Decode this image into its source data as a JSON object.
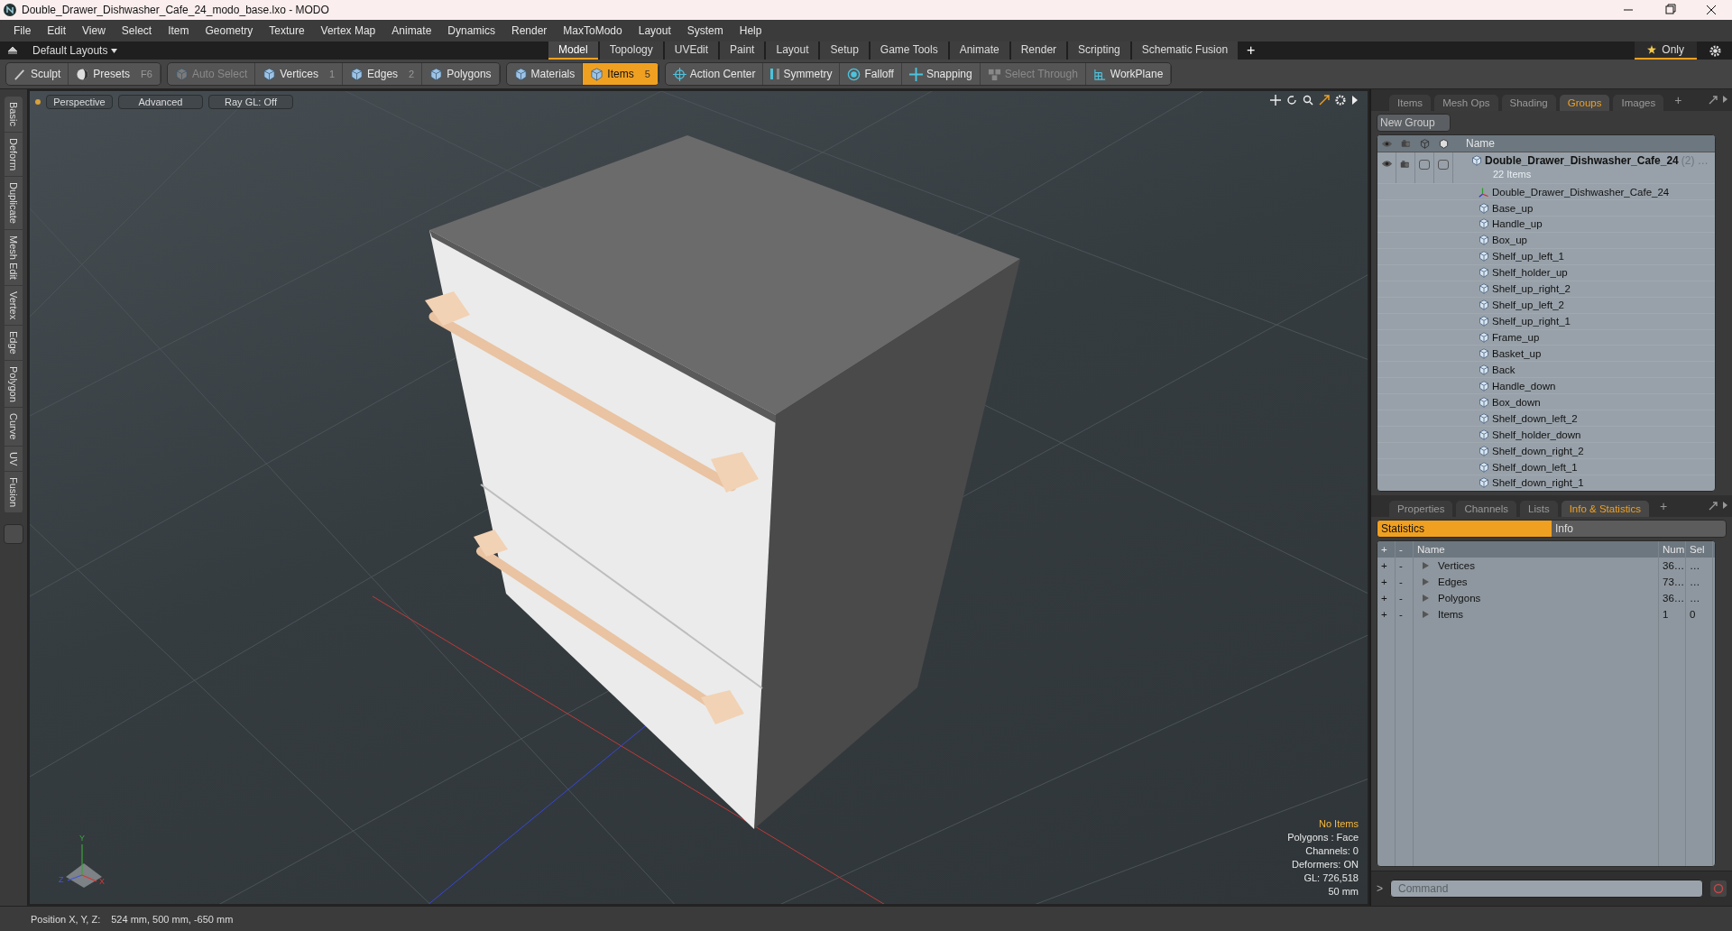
{
  "window": {
    "title": "Double_Drawer_Dishwasher_Cafe_24_modo_base.lxo - MODO"
  },
  "menu": [
    "File",
    "Edit",
    "View",
    "Select",
    "Item",
    "Geometry",
    "Texture",
    "Vertex Map",
    "Animate",
    "Dynamics",
    "Render",
    "MaxToModo",
    "Layout",
    "System",
    "Help"
  ],
  "layouts_menu": "Default Layouts",
  "layout_tabs": [
    {
      "label": "Model",
      "selected": true
    },
    {
      "label": "Topology",
      "selected": false
    },
    {
      "label": "UVEdit",
      "selected": false
    },
    {
      "label": "Paint",
      "selected": false
    },
    {
      "label": "Layout",
      "selected": false
    },
    {
      "label": "Setup",
      "selected": false
    },
    {
      "label": "Game Tools",
      "selected": false
    },
    {
      "label": "Animate",
      "selected": false
    },
    {
      "label": "Render",
      "selected": false
    },
    {
      "label": "Scripting",
      "selected": false
    },
    {
      "label": "Schematic Fusion",
      "selected": false
    }
  ],
  "add_tab": "+",
  "only_button": "Only",
  "toolbar": [
    [
      {
        "label": "Sculpt",
        "kind": "brush",
        "selected": false,
        "disabled": false
      },
      {
        "label": "Presets",
        "shortcut": "F6",
        "kind": "sphere",
        "selected": false,
        "disabled": false
      }
    ],
    [
      {
        "label": "Auto Select",
        "kind": "cube",
        "selected": false,
        "disabled": true
      },
      {
        "label": "Vertices",
        "shortcut": "1",
        "kind": "cube",
        "selected": false,
        "disabled": false
      },
      {
        "label": "Edges",
        "shortcut": "2",
        "kind": "cube",
        "selected": false,
        "disabled": false
      },
      {
        "label": "Polygons",
        "kind": "cube",
        "selected": false,
        "disabled": false
      }
    ],
    [
      {
        "label": "Materials",
        "kind": "cube",
        "selected": false,
        "disabled": false
      },
      {
        "label": "Items",
        "shortcut": "5",
        "kind": "cube",
        "selected": true,
        "disabled": false
      }
    ],
    [
      {
        "label": "Action Center",
        "kind": "target",
        "selected": false,
        "disabled": false
      },
      {
        "label": "Symmetry",
        "kind": "mirror",
        "selected": false,
        "disabled": false
      },
      {
        "label": "Falloff",
        "kind": "falloff",
        "selected": false,
        "disabled": false
      },
      {
        "label": "Snapping",
        "kind": "snap",
        "selected": false,
        "disabled": false
      },
      {
        "label": "Select Through",
        "kind": "cubes",
        "selected": false,
        "disabled": true
      },
      {
        "label": "WorkPlane",
        "kind": "plane",
        "selected": false,
        "disabled": false
      }
    ]
  ],
  "side_tabs": [
    "Basic",
    "Deform",
    "Duplicate",
    "Mesh Edit",
    "Vertex",
    "Edge",
    "Polygon",
    "Curve",
    "UV",
    "Fusion"
  ],
  "viewport": {
    "buttons": [
      "Perspective",
      "Advanced",
      "Ray GL: Off"
    ],
    "selection": "No Items",
    "info": [
      "Polygons : Face",
      "Channels: 0",
      "Deformers: ON",
      "GL: 726,518",
      "50 mm"
    ],
    "axes": [
      "Y",
      "Z",
      "X"
    ]
  },
  "groups_panel": {
    "tabs": [
      {
        "label": "Items",
        "selected": false
      },
      {
        "label": "Mesh Ops",
        "selected": false
      },
      {
        "label": "Shading",
        "selected": false
      },
      {
        "label": "Groups",
        "selected": true
      },
      {
        "label": "Images",
        "selected": false
      }
    ],
    "add_tab": "+",
    "new_group": "New Group",
    "name_column": "Name",
    "group": {
      "name": "Double_Drawer_Dishwasher_Cafe_24",
      "suffix": "(2) …",
      "count": "22 Items",
      "toggles": [
        {
          "checked": false
        },
        {
          "checked": false
        }
      ]
    },
    "items": [
      {
        "name": "Double_Drawer_Dishwasher_Cafe_24",
        "kind": "locator"
      },
      {
        "name": "Base_up",
        "kind": "mesh"
      },
      {
        "name": "Handle_up",
        "kind": "mesh"
      },
      {
        "name": "Box_up",
        "kind": "mesh"
      },
      {
        "name": "Shelf_up_left_1",
        "kind": "mesh"
      },
      {
        "name": "Shelf_holder_up",
        "kind": "mesh"
      },
      {
        "name": "Shelf_up_right_2",
        "kind": "mesh"
      },
      {
        "name": "Shelf_up_left_2",
        "kind": "mesh"
      },
      {
        "name": "Shelf_up_right_1",
        "kind": "mesh"
      },
      {
        "name": "Frame_up",
        "kind": "mesh"
      },
      {
        "name": "Basket_up",
        "kind": "mesh"
      },
      {
        "name": "Back",
        "kind": "mesh"
      },
      {
        "name": "Handle_down",
        "kind": "mesh"
      },
      {
        "name": "Box_down",
        "kind": "mesh"
      },
      {
        "name": "Shelf_down_left_2",
        "kind": "mesh"
      },
      {
        "name": "Shelf_holder_down",
        "kind": "mesh"
      },
      {
        "name": "Shelf_down_right_2",
        "kind": "mesh"
      },
      {
        "name": "Shelf_down_left_1",
        "kind": "mesh"
      },
      {
        "name": "Shelf_down_right_1",
        "kind": "mesh"
      }
    ]
  },
  "stats_panel": {
    "tabs": [
      {
        "label": "Properties",
        "selected": false
      },
      {
        "label": "Channels",
        "selected": false
      },
      {
        "label": "Lists",
        "selected": false
      },
      {
        "label": "Info & Statistics",
        "selected": true
      }
    ],
    "add_tab": "+",
    "subtabs": [
      {
        "label": "Statistics",
        "selected": true
      },
      {
        "label": "Info",
        "selected": false
      }
    ],
    "columns": [
      "+",
      "-",
      "Name",
      "Num",
      "Sel"
    ],
    "rows": [
      {
        "add": "+",
        "remove": "-",
        "name": "Vertices",
        "num": "36…",
        "sel": "…"
      },
      {
        "add": "+",
        "remove": "-",
        "name": "Edges",
        "num": "73…",
        "sel": "…"
      },
      {
        "add": "+",
        "remove": "-",
        "name": "Polygons",
        "num": "36…",
        "sel": "…"
      },
      {
        "add": "+",
        "remove": "-",
        "name": "Items",
        "num": "1",
        "sel": "0"
      }
    ]
  },
  "command": {
    "prompt": ">",
    "placeholder": "Command"
  },
  "status_bar": {
    "label": "Position X, Y, Z:",
    "value": "524 mm, 500 mm, -650 mm"
  }
}
